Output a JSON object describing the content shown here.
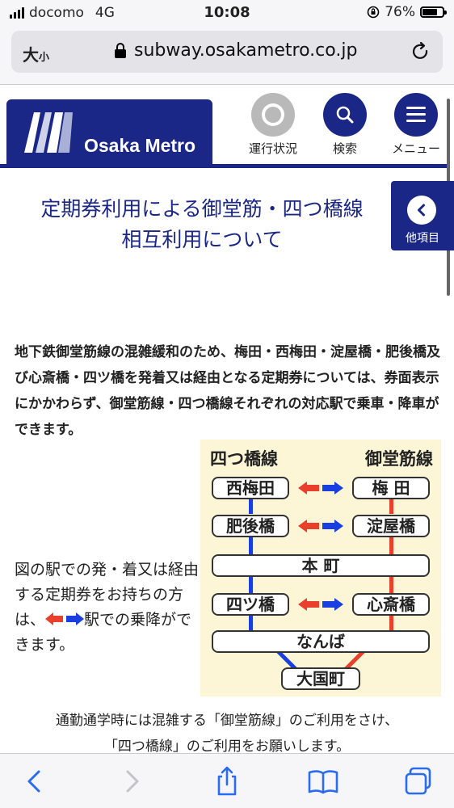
{
  "status_bar": {
    "carrier": "docomo",
    "network": "4G",
    "time": "10:08",
    "battery_percent": "76%",
    "battery_level": 0.76
  },
  "browser": {
    "text_size_label": "大",
    "text_size_small": "小",
    "url": "subway.osakametro.co.jp",
    "lock_icon": "lock-icon",
    "reload_icon": "reload-icon"
  },
  "site": {
    "logo_text": "Osaka Metro",
    "brand_color": "#1b2787",
    "nav": [
      {
        "label": "運行状況",
        "icon": "status-circle-icon"
      },
      {
        "label": "検索",
        "icon": "search-icon"
      },
      {
        "label": "メニュー",
        "icon": "menu-icon"
      }
    ],
    "side_tab_label": "他項目"
  },
  "main": {
    "title_line1": "定期券利用による御堂筋・四つ橋線",
    "title_line2": "相互利用について",
    "intro": "地下鉄御堂筋線の混雑緩和のため、梅田・西梅田・淀屋橋・肥後橋及び心斎橋・四ツ橋を発着又は経由となる定期券については、券面表示にかかわらず、御堂筋線・四つ橋線それぞれの対応駅で乗車・降車ができます。",
    "caption_part1": "図の駅での発・着又は経由する定期券をお持ちの方は、",
    "caption_part2": "駅での乗降ができます。",
    "note_line1": "通勤通学時には混雑する「御堂筋線」のご利用をさけ、",
    "note_line2": "「四つ橋線」のご利用をお願いします。"
  },
  "diagram": {
    "left_line_label": "四つ橋線",
    "right_line_label": "御堂筋線",
    "left_line_color": "#1a3fe0",
    "right_line_color": "#e8402a",
    "pairs": [
      {
        "left": "西梅田",
        "right": "梅 田"
      },
      {
        "left": "肥後橋",
        "right": "淀屋橋"
      },
      {
        "left": "四ツ橋",
        "right": "心斎橋"
      }
    ],
    "shared": [
      "本 町",
      "なんば"
    ],
    "terminal": "大国町"
  }
}
